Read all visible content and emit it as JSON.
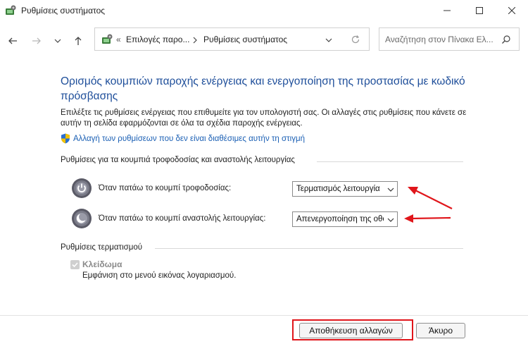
{
  "window": {
    "title": "Ρυθμίσεις συστήματος"
  },
  "nav": {
    "breadcrumb_sep": "«",
    "crumbs": [
      "Επιλογές παρο...",
      "Ρυθμίσεις συστήματος"
    ],
    "search_placeholder": "Αναζήτηση στον Πίνακα Ελ..."
  },
  "main": {
    "heading": "Ορισμός κουμπιών παροχής ενέργειας και ενεργοποίηση της προστασίας με κωδικό πρόσβασης",
    "description": "Επιλέξτε τις ρυθμίσεις ενέργειας που επιθυμείτε για τον υπολογιστή σας. Οι αλλαγές στις ρυθμίσεις που κάνετε σε αυτήν τη σελίδα εφαρμόζονται σε όλα τα σχέδια παροχής ενέργειας.",
    "change_link": "Αλλαγή των ρυθμίσεων που δεν είναι διαθέσιμες αυτήν τη στιγμή",
    "buttons_group": {
      "label": "Ρυθμίσεις για τα κουμπιά τροφοδοσίας και αναστολής λειτουργίας",
      "power_label": "Όταν πατάω το κουμπί τροφοδοσίας:",
      "power_value": "Τερματισμός λειτουργία",
      "sleep_label": "Όταν πατάω το κουμπί αναστολής λειτουργίας:",
      "sleep_value": "Απενεργοποίηση της οθόνης"
    },
    "shutdown_group": {
      "label": "Ρυθμίσεις τερματισμού",
      "lock_label": "Κλείδωμα",
      "lock_desc": "Εμφάνιση στο μενού εικόνας λογαριασμού.",
      "lock_checked": true
    }
  },
  "footer": {
    "save_label": "Αποθήκευση αλλαγών",
    "cancel_label": "Άκυρο"
  },
  "colors": {
    "heading": "#1e4e9a",
    "link": "#1a5fb4",
    "annotation": "#e0161b"
  }
}
